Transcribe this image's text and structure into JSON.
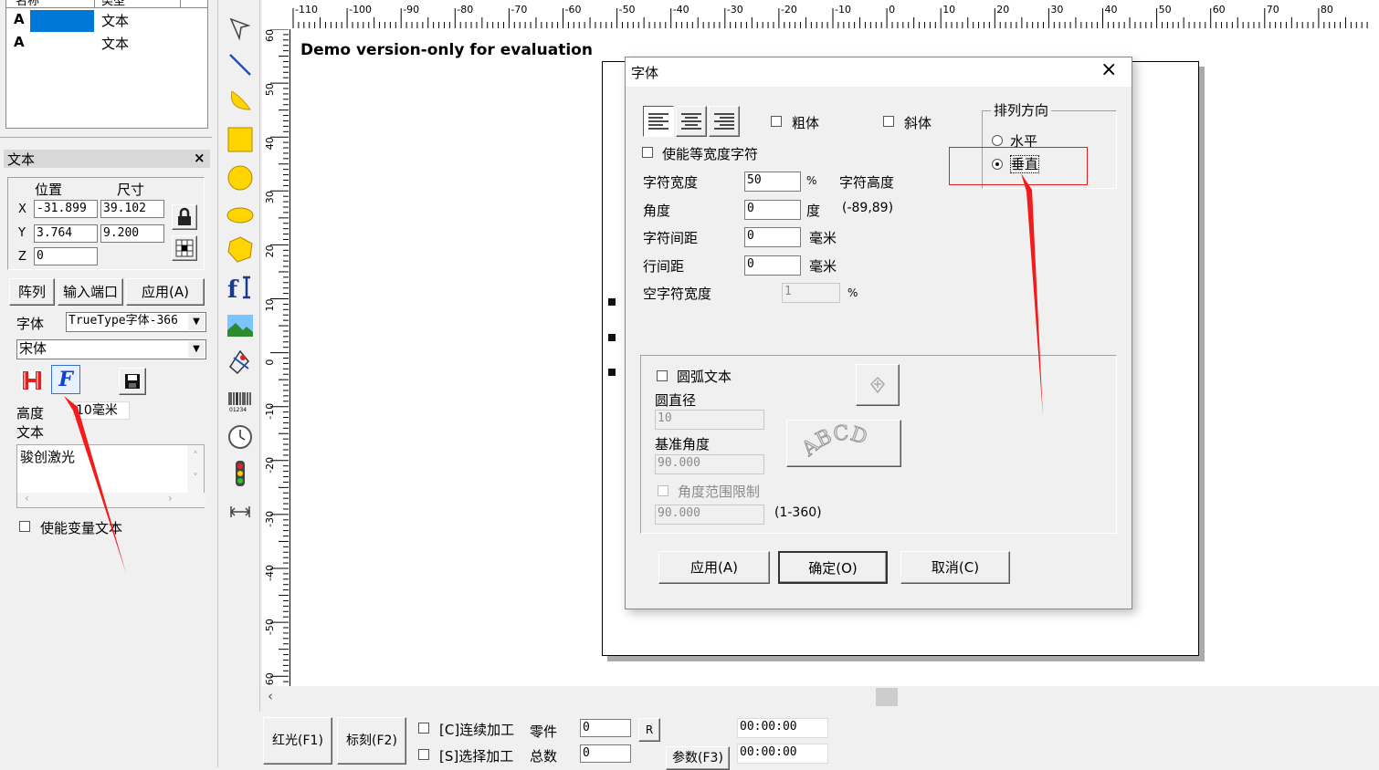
{
  "object_list": {
    "headers": [
      "名称",
      "类型"
    ],
    "rows": [
      {
        "name": "A",
        "type": "文本"
      },
      {
        "name": "A",
        "type": "文本"
      }
    ]
  },
  "prop_panel": {
    "title": "文本",
    "close": "×",
    "pos_label": "位置",
    "size_label": "尺寸",
    "x_label": "X",
    "y_label": "Y",
    "z_label": "Z",
    "x_pos": "-31.899",
    "x_size": "39.102",
    "y_pos": "3.764",
    "y_size": "9.200",
    "z_pos": "0",
    "array_btn": "阵列",
    "import_btn": "输入端口",
    "apply_btn": "应用(A)",
    "font_label": "字体",
    "font_type": "TrueType字体-366",
    "font_name": "宋体",
    "height_label": "高度",
    "height_value": "10毫米",
    "text_label": "文本",
    "text_value": "骏创激光",
    "variable_text": "使能变量文本"
  },
  "ruler": {
    "h_labels": [
      "-110",
      "-100",
      "-90",
      "-80",
      "-70",
      "-60",
      "-50",
      "-40",
      "-30",
      "-20",
      "-10",
      "0",
      "10",
      "20",
      "30",
      "40",
      "50",
      "60",
      "70",
      "80"
    ],
    "v_labels": [
      "60",
      "50",
      "40",
      "30",
      "20",
      "10",
      "0",
      "-10",
      "-20",
      "-30",
      "-40",
      "-50",
      "-60"
    ]
  },
  "canvas": {
    "watermark": "Demo version-only for evaluation"
  },
  "bottom_bar": {
    "redlight_btn": "红光(F1)",
    "mark_btn": "标刻(F2)",
    "continuous": "[C]连续加工",
    "select": "[S]选择加工",
    "parts_label": "零件",
    "total_label": "总数",
    "parts_value": "0",
    "total_value": "0",
    "r_btn": "R",
    "params_btn": "参数(F3)",
    "time1": "00:00:00",
    "time2": "00:00:00"
  },
  "dialog": {
    "title": "字体",
    "close": "×",
    "bold": "粗体",
    "italic": "斜体",
    "fixed_width": "使能等宽度字符",
    "char_width_label": "字符宽度",
    "char_width": "50",
    "percent": "%",
    "char_height_label": "字符高度",
    "angle_label": "角度",
    "angle": "0",
    "degree": "度",
    "angle_range": "(-89,89)",
    "spacing_label": "字符间距",
    "spacing": "0",
    "mm1": "毫米",
    "line_spacing_label": "行间距",
    "line_spacing": "0",
    "mm2": "毫米",
    "blank_width_label": "空字符宽度",
    "blank_width": "1",
    "percent2": "%",
    "direction_group": "排列方向",
    "horizontal": "水平",
    "vertical": "垂直",
    "arc_text": "圆弧文本",
    "diameter_label": "圆直径",
    "diameter": "10",
    "base_angle_label": "基准角度",
    "base_angle": "90.000",
    "angle_limit": "角度范围限制",
    "angle_limit_value": "90.000",
    "angle_limit_range": "(1-360)",
    "abcd": "ABCD",
    "apply": "应用(A)",
    "ok": "确定(O)",
    "cancel": "取消(C)"
  }
}
